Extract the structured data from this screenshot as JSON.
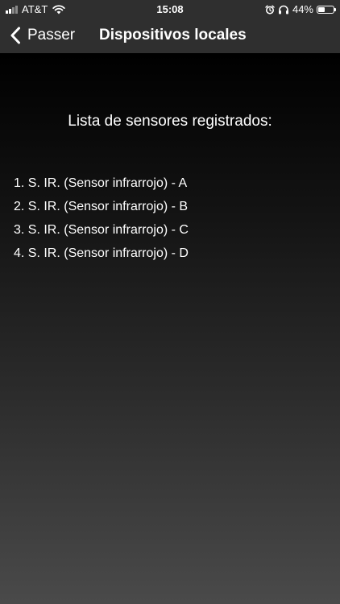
{
  "status_bar": {
    "carrier": "AT&T",
    "time": "15:08",
    "battery_percent": "44%",
    "battery_level": 0.44,
    "signal_bars_active": 2,
    "icons": [
      "signal-icon",
      "wifi-icon",
      "alarm-icon",
      "headphones-icon",
      "battery-icon"
    ]
  },
  "nav": {
    "back_label": "Passer",
    "title": "Dispositivos locales"
  },
  "main": {
    "heading": "Lista de sensores registrados:",
    "sensors": [
      "1. S. IR. (Sensor infrarrojo) - A",
      "2. S. IR. (Sensor infrarrojo) - B",
      "3. S. IR. (Sensor infrarrojo) - C",
      "4. S. IR. (Sensor infrarrojo) - D"
    ]
  },
  "colors": {
    "bar_background": "#2f2f2f",
    "text": "#ffffff",
    "content_gradient_top": "#000000",
    "content_gradient_bottom": "#4a4a4a"
  }
}
